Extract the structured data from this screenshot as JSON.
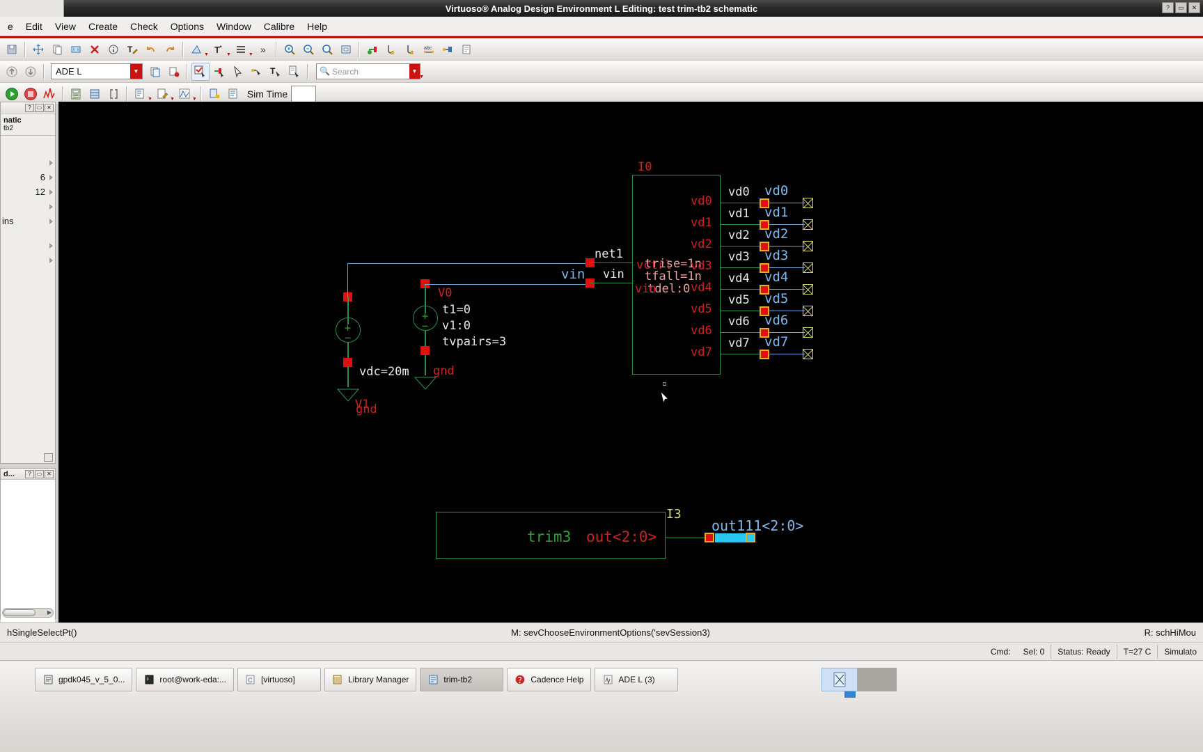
{
  "window": {
    "title": "Virtuoso® Analog Design Environment L Editing: test trim-tb2 schematic",
    "buttons": [
      "?",
      "▭",
      "✕"
    ]
  },
  "menubar": {
    "items": [
      {
        "label": "e",
        "accel": ""
      },
      {
        "label": "Edit",
        "accel": "E"
      },
      {
        "label": "View",
        "accel": "V"
      },
      {
        "label": "Create",
        "accel": "C"
      },
      {
        "label": "Check",
        "accel": "C"
      },
      {
        "label": "Options",
        "accel": "O"
      },
      {
        "label": "Window",
        "accel": "W"
      },
      {
        "label": "Calibre",
        "accel": "b"
      },
      {
        "label": "Help",
        "accel": "H"
      }
    ]
  },
  "toolbar2": {
    "session_combo_value": "ADE L",
    "search_placeholder": "Search"
  },
  "toolbar3": {
    "sim_time_label": "Sim Time",
    "sim_time_value": ""
  },
  "navigator": {
    "title_buttons": [
      "?",
      "▭",
      "✕"
    ],
    "heading": "natic",
    "subheading": "tb2",
    "rows": [
      {
        "value": ""
      },
      {
        "value": "6"
      },
      {
        "value": "12"
      },
      {
        "value": ""
      },
      {
        "value": "ins"
      },
      {
        "value": ""
      },
      {
        "value": ""
      }
    ]
  },
  "command_panel": {
    "title": "d...",
    "title_buttons": [
      "?",
      "▭",
      "✕"
    ]
  },
  "schematic": {
    "instances": [
      {
        "name": "I0",
        "type": "block"
      },
      {
        "name": "I3",
        "type": "block",
        "cellname": "trim3",
        "port": "out<2:0>"
      },
      {
        "name": "V1",
        "type": "vdc",
        "params": [
          "vdc=20m"
        ]
      },
      {
        "name": "V0",
        "type": "vpulse",
        "params": [
          "t1=0",
          "v1:0",
          "tvpairs=3"
        ]
      }
    ],
    "ground_labels": [
      "gnd",
      "gnd"
    ],
    "net_labels_white": [
      "net1",
      "vin"
    ],
    "net_labels_blue": [
      "vin",
      "out111<2:0>"
    ],
    "block_params_overlap": [
      "vctrl",
      "trise=1n",
      "tfall=1n",
      "tdel:0",
      "vin"
    ],
    "block_pins_red": [
      "vd0",
      "vd1",
      "vd2",
      "vd3",
      "vd4",
      "vd5",
      "vd6",
      "vd7"
    ],
    "wire_labels_white": [
      "vd0",
      "vd1",
      "vd2",
      "vd3",
      "vd4",
      "vd5",
      "vd6",
      "vd7"
    ],
    "wire_labels_blue": [
      "vd0",
      "vd1",
      "vd2",
      "vd3",
      "vd4",
      "vd5",
      "vd6",
      "vd7"
    ],
    "trim_block": {
      "instance": "I3",
      "cell": "trim3",
      "port": "out<2:0>",
      "bus_label": "out111<2:0>"
    },
    "colors": {
      "background": "#000000",
      "wire_green": "#2f8f4f",
      "wire_blue": "#6fa8dc",
      "label_red": "#cc2222",
      "label_white": "#e8e8e8",
      "label_blue": "#7fb8e8",
      "pin_red": "#e01010",
      "pin_yellow": "#d8d860",
      "selected_cyan": "#28c8f0"
    }
  },
  "statusbar": {
    "left": "hSingleSelectPt()",
    "middle": "M: sevChooseEnvironmentOptions('sevSession3)",
    "right": "R: schHiMou"
  },
  "infobar": {
    "cmd_label": "Cmd:",
    "sel_label": "Sel: 0",
    "status": "Status: Ready",
    "temperature": "T=27 C",
    "simulator": "Simulato"
  },
  "taskbar": {
    "tasks": [
      {
        "label": "gpdk045_v_5_0...",
        "icon": "terminal-icon",
        "active": false
      },
      {
        "label": "root@work-eda:...",
        "icon": "terminal-icon",
        "active": false
      },
      {
        "label": "[virtuoso]",
        "icon": "virtuoso-icon",
        "active": false
      },
      {
        "label": "Library Manager",
        "icon": "library-icon",
        "active": false
      },
      {
        "label": "trim-tb2",
        "icon": "schematic-icon",
        "active": true
      },
      {
        "label": "Cadence Help",
        "icon": "help-icon",
        "active": false
      },
      {
        "label": "ADE L (3)",
        "icon": "ade-icon",
        "active": false
      }
    ]
  }
}
